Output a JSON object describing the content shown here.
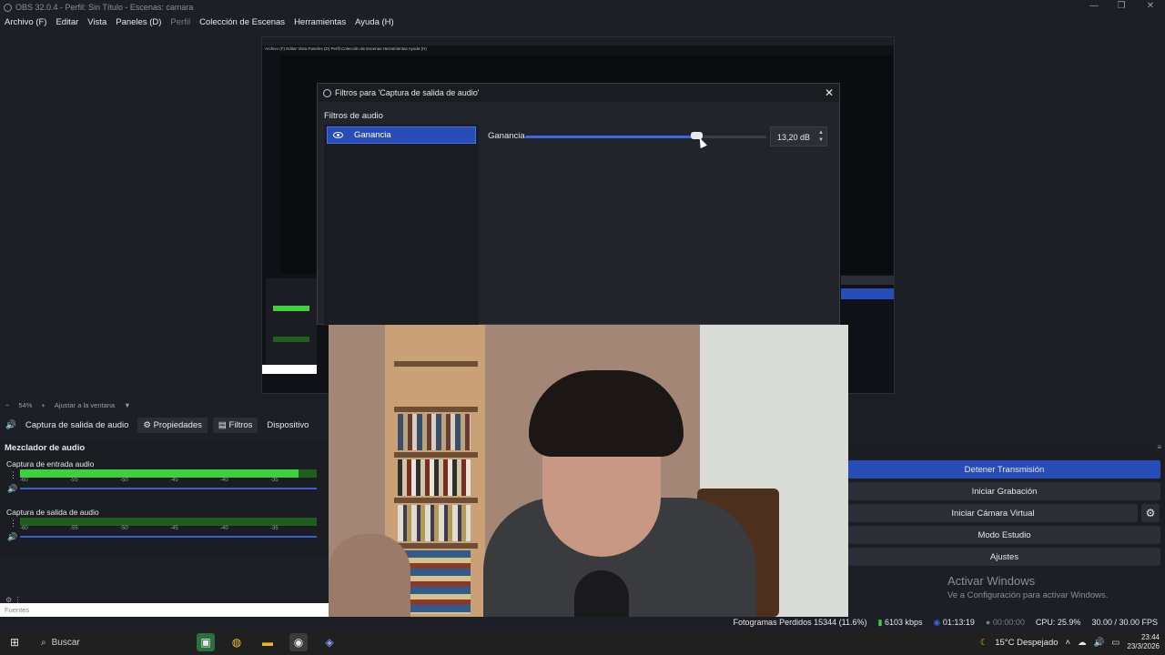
{
  "window": {
    "title": "OBS 32.0.4 - Perfil: Sin Título - Escenas: camara"
  },
  "menu": {
    "items": [
      "Archivo (F)",
      "Editar",
      "Vista",
      "Paneles (D)",
      "Perfil",
      "Colección de Escenas",
      "Herramientas",
      "Ayuda (H)"
    ]
  },
  "preview": {
    "nested_menu": "Archivo (F)   Editar   Vista   Paneles (D)   Perfil   Colección de Escenas   Herramientas   Ayuda (H)"
  },
  "dialog": {
    "title": "Filtros para 'Captura de salida de audio'",
    "section_label": "Filtros de audio",
    "filter_item": "Ganancia",
    "gain_label": "Ganancia",
    "gain_value": "13,20 dB",
    "gain_fraction": 0.71
  },
  "zoom": {
    "value": "54%",
    "fit_label": "Ajustar a la ventana"
  },
  "source_toolbar": {
    "source_name": "Captura de salida de audio",
    "properties": "Propiedades",
    "filters": "Filtros",
    "device": "Dispositivo"
  },
  "mixer": {
    "title": "Mezclador de audio",
    "channels": [
      {
        "name": "Captura de entrada audio",
        "level": 0.94
      },
      {
        "name": "Captura de salida de audio",
        "level": 0.0
      }
    ],
    "tick_labels": [
      "-60",
      "-55",
      "-50",
      "-45",
      "-40",
      "-35"
    ]
  },
  "sources_dock": {
    "label": "Fuentes"
  },
  "controls": {
    "stop_stream": "Detener Transmisión",
    "start_record": "Iniciar Grabación",
    "start_virtualcam": "Iniciar Cámara Virtual",
    "studio_mode": "Modo Estudio",
    "settings": "Ajustes"
  },
  "activation": {
    "line1": "Activar Windows",
    "line2": "Ve a Configuración para activar Windows."
  },
  "status": {
    "dropped_frames": "Fotogramas Perdidos 15344 (11.6%)",
    "bitrate": "6103 kbps",
    "stream_time": "01:13:19",
    "record_time": "00:00:00",
    "cpu": "CPU: 25.9%",
    "fps": "30.00 / 30.00 FPS"
  },
  "taskbar": {
    "search": "Buscar",
    "weather": "15°C  Despejado",
    "time": "23:44",
    "date": "23/3/2026"
  },
  "colors": {
    "accent": "#284cb8",
    "meter_green": "#3dd13d"
  }
}
